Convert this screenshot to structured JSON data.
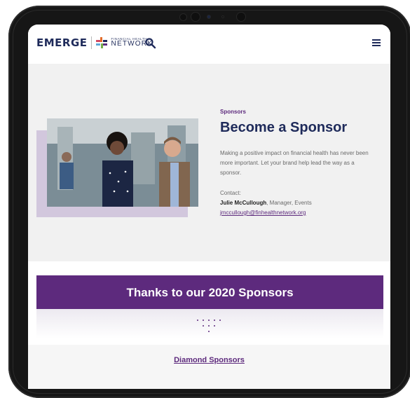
{
  "header": {
    "logo_emerge": "EMERGE",
    "logo_small": "FINANCIAL HEALTH",
    "logo_network": "NETWORK"
  },
  "hero": {
    "eyebrow": "Sponsors",
    "title": "Become a Sponsor",
    "text": "Making a positive impact on financial health has never been more important. Let your brand help lead the way as a sponsor.",
    "contact_label": "Contact:",
    "contact_name": "Julie McCullough",
    "contact_role": ", Manager, Events",
    "contact_email": "jmccullough@finhealthnetwork.org"
  },
  "sponsors": {
    "banner_title": "Thanks to our 2020 Sponsors",
    "diamond_label": "Diamond Sponsors"
  },
  "colors": {
    "brand_purple": "#5d2a7d",
    "brand_navy": "#1e2a5a",
    "hero_bg": "#f1f1f1",
    "photo_shadow": "#d2c7dd"
  }
}
